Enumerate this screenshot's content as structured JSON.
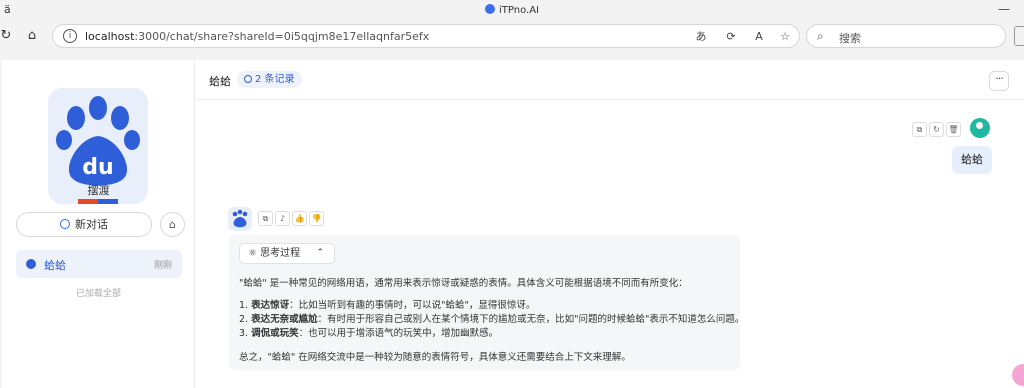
{
  "browser": {
    "tab_title": "iTPno.AI",
    "url_host": "localhost",
    "url_path": ":3000/chat/share?shareId=0i5qqjm8e17ellaqnfar5efx",
    "search_placeholder": "搜索"
  },
  "sidebar": {
    "app_name": "摆渡",
    "new_chat_label": "新对话",
    "history": [
      {
        "label": "蛤蛤",
        "time": "刚刚"
      }
    ],
    "loaded_all": "已加载全部"
  },
  "chat": {
    "title": "蛤蛤",
    "record_badge": "2 条记录",
    "user_message": "蛤蛤",
    "thinking_label": "思考过程",
    "answer": {
      "intro": "\"蛤蛤\" 是一种常见的网络用语，通常用来表示惊讶或疑惑的表情。具体含义可能根据语境不同而有所变化：",
      "items": [
        {
          "num": "1.",
          "title": "表达惊讶",
          "text": "：比如当听到有趣的事情时，可以说\"蛤蛤\"，显得很惊讶。"
        },
        {
          "num": "2.",
          "title": "表达无奈或尴尬",
          "text": "：有时用于形容自己或别人在某个情境下的尴尬或无奈，比如\"问题的时候蛤蛤\"表示不知道怎么问题。"
        },
        {
          "num": "3.",
          "title": "调侃或玩笑",
          "text": "：也可以用于增添语气的玩笑中，增加幽默感。"
        }
      ],
      "summary": "总之，\"蛤蛤\" 在网络交流中是一种较为随意的表情符号，具体意义还需要结合上下文来理解。"
    }
  },
  "colors": {
    "accent": "#2f5fd8",
    "user_bubble": "#e6eefc",
    "answer_bg": "#f5f6f8"
  }
}
